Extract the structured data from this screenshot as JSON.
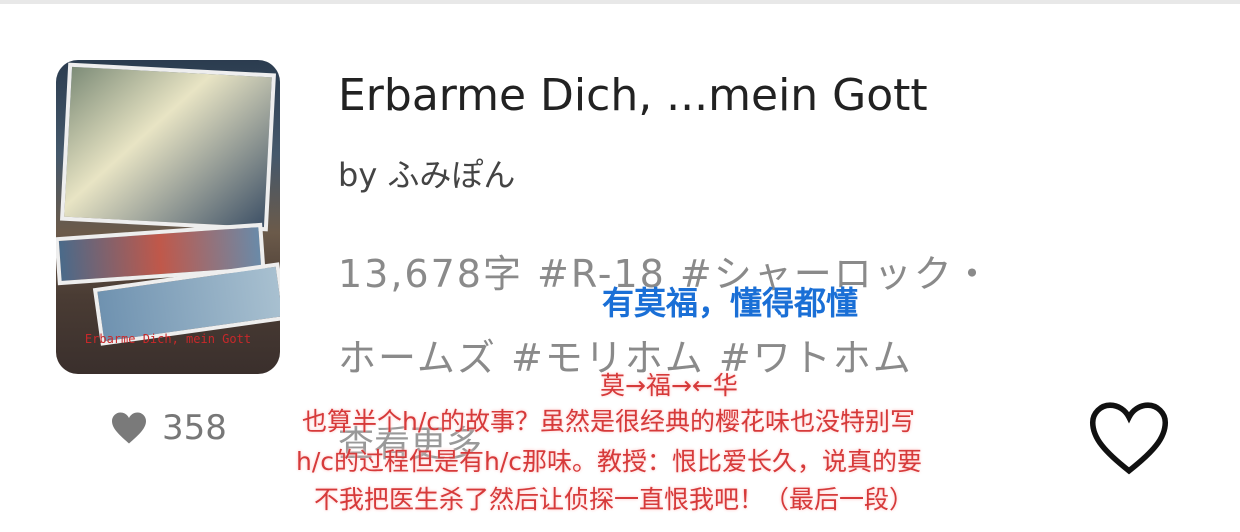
{
  "work": {
    "title": "Erbarme Dich, ...mein Gott",
    "author": "by ふみぽん",
    "cover_text": "Erbarme Dich, mein Gott",
    "tags_line1": "13,678字 #R-18 #シャーロック・",
    "tags_line2": "ホームズ #モリホム #ワトホム",
    "see_more": "查看更多",
    "likes": "358"
  },
  "annotations": {
    "blue": "有莫福，懂得都懂",
    "arrow": "莫→福→←华",
    "line1": "也算半个h/c的故事？虽然是很经典的樱花味也没特别写",
    "line2": "h/c的过程但是有h/c那味。教授：恨比爱长久，说真的要",
    "line3": "不我把医生杀了然后让侦探一直恨我吧！（最后一段）"
  },
  "colors": {
    "annotation_red": "#d63a3a",
    "annotation_blue": "#1a6fd6"
  },
  "icons": {
    "like": "heart-icon",
    "favorite": "heart-outline-icon"
  }
}
